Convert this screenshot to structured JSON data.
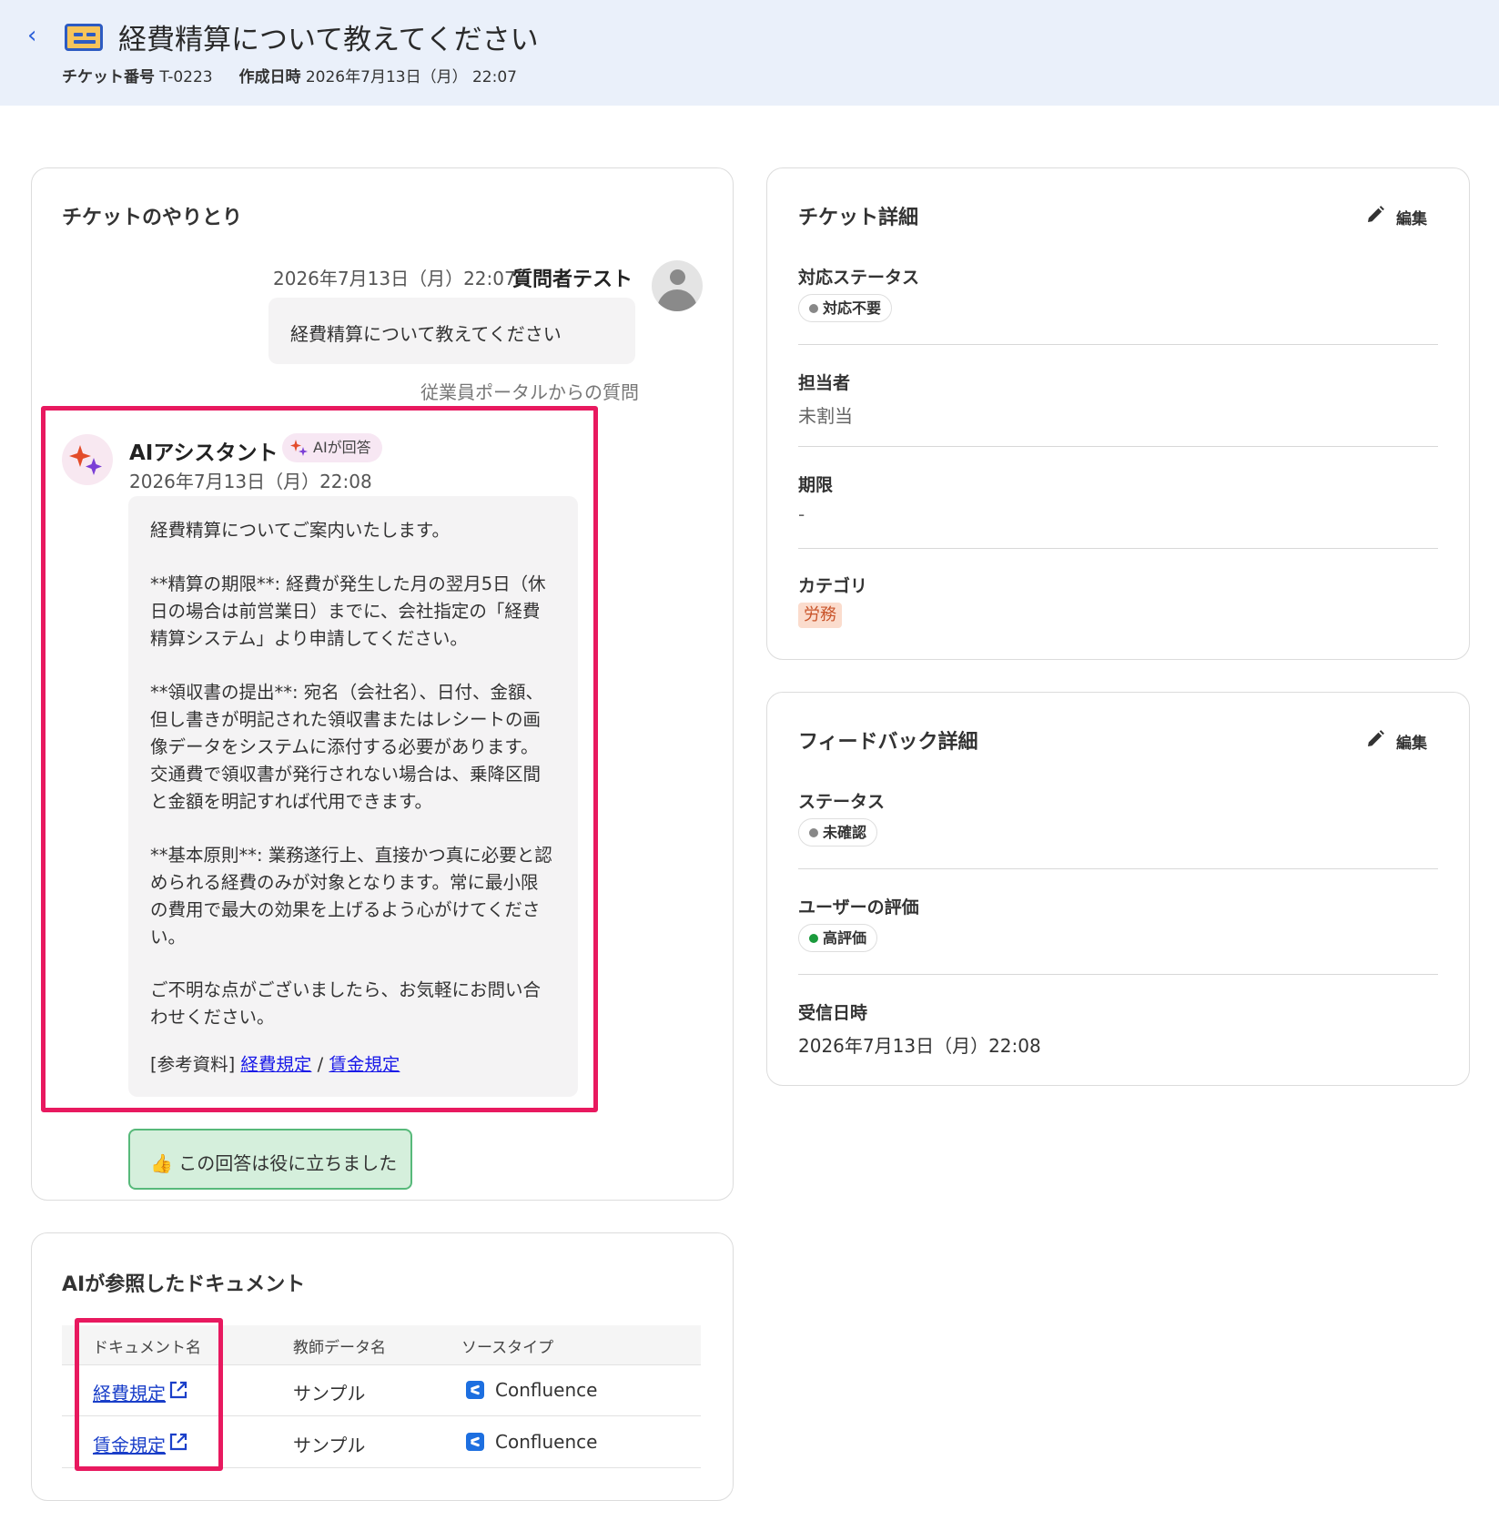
{
  "header": {
    "title": "経費精算について教えてください",
    "ticket_no_label": "チケット番号",
    "ticket_no": "T-0223",
    "created_label": "作成日時",
    "created_at": "2026年7月13日（月） 22:07"
  },
  "conversation": {
    "title": "チケットのやりとり",
    "question": {
      "time": "2026年7月13日（月）22:07",
      "author": "質問者テスト",
      "text": "経費精算について教えてください",
      "source": "従業員ポータルからの質問"
    },
    "answer": {
      "author": "AIアシスタント",
      "badge": "AIが回答",
      "time": "2026年7月13日（月）22:08",
      "lines": [
        "経費精算についてご案内いたします。",
        "**精算の期限**: 経費が発生した月の翌月5日（休",
        "日の場合は前営業日）までに、会社指定の「経費",
        "精算システム」より申請してください。",
        "**領収書の提出**: 宛名（会社名）、日付、金額、",
        "但し書きが明記された領収書またはレシートの画",
        "像データをシステムに添付する必要があります。",
        "交通費で領収書が発行されない場合は、乗降区間",
        "と金額を明記すれば代用できます。",
        "**基本原則**: 業務遂行上、直接かつ真に必要と認",
        "められる経費のみが対象となります。常に最小限",
        "の費用で最大の効果を上げるよう心がけてくださ",
        "い。",
        "ご不明な点がございましたら、お気軽にお問い合",
        "わせください。"
      ],
      "ref_prefix": "[参考資料]",
      "ref_links": [
        "経費規定",
        "賃金規定"
      ],
      "ref_sep": "/"
    },
    "helpful_button": "👍 この回答は役に立ちました"
  },
  "documents": {
    "title": "AIが参照したドキュメント",
    "columns": [
      "ドキュメント名",
      "教師データ名",
      "ソースタイプ"
    ],
    "rows": [
      {
        "name": "経費規定",
        "training": "サンプル",
        "source": "Confluence"
      },
      {
        "name": "賃金規定",
        "training": "サンプル",
        "source": "Confluence"
      }
    ]
  },
  "ticket_details": {
    "title": "チケット詳細",
    "edit_label": "編集",
    "status_label": "対応ステータス",
    "status_value": "対応不要",
    "assignee_label": "担当者",
    "assignee_value": "未割当",
    "due_label": "期限",
    "due_value": "-",
    "category_label": "カテゴリ",
    "category_value": "労務"
  },
  "feedback_details": {
    "title": "フィードバック詳細",
    "edit_label": "編集",
    "status_label": "ステータス",
    "status_value": "未確認",
    "rating_label": "ユーザーの評価",
    "rating_value": "高評価",
    "received_label": "受信日時",
    "received_value": "2026年7月13日（月）22:08"
  },
  "colors": {
    "highlight": "#e8195f",
    "header_bg": "#eaf0fa",
    "link": "#1a3fc9",
    "status_gray": "#888888",
    "status_green": "#1a9a3c",
    "category_bg": "#fbdccd",
    "category_text": "#c9542a"
  },
  "icons": [
    "back-chevron-icon",
    "ticket-icon",
    "user-avatar-icon",
    "sparkle-icon",
    "pencil-icon",
    "external-link-icon",
    "confluence-icon"
  ]
}
